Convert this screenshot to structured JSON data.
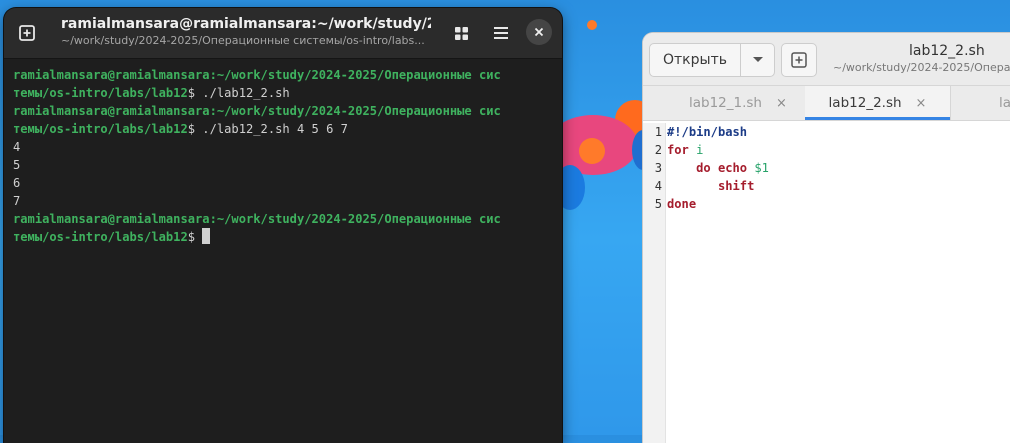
{
  "terminal": {
    "title": "ramialmansara@ramialmansara:~/work/study/2024...",
    "subtitle": "~/work/study/2024-2025/Операционные системы/os-intro/labs...",
    "lines": [
      {
        "prompt": "ramialmansara@ramialmansara:~/work/study/2024-2025/Операционные сис",
        "cmd": ""
      },
      {
        "prompt": "темы/os-intro/labs/lab12",
        "cmd": "$ ./lab12_2.sh"
      },
      {
        "prompt": "ramialmansara@ramialmansara:~/work/study/2024-2025/Операционные сис",
        "cmd": ""
      },
      {
        "prompt": "темы/os-intro/labs/lab12",
        "cmd": "$ ./lab12_2.sh 4 5 6 7"
      },
      {
        "prompt": "",
        "cmd": "4"
      },
      {
        "prompt": "",
        "cmd": "5"
      },
      {
        "prompt": "",
        "cmd": "6"
      },
      {
        "prompt": "",
        "cmd": "7"
      },
      {
        "prompt": "ramialmansara@ramialmansara:~/work/study/2024-2025/Операционные сис",
        "cmd": ""
      },
      {
        "prompt": "темы/os-intro/labs/lab12",
        "cmd": "$ "
      }
    ]
  },
  "editor": {
    "open_label": "Открыть",
    "title": "lab12_2.sh",
    "path": "~/work/study/2024-2025/Опера",
    "tabs": [
      {
        "label": "lab12_1.sh",
        "close": "×"
      },
      {
        "label": "lab12_2.sh",
        "close": "×"
      },
      {
        "label": "la"
      }
    ],
    "line_numbers": [
      "1",
      "2",
      "3",
      "4",
      "5"
    ],
    "code": {
      "l1": "#!/bin/bash",
      "l2_kw": "for",
      "l2_var": "i",
      "l3_indent": "    ",
      "l3_kw1": "do",
      "l3_kw2": "echo",
      "l3_arg": "$1",
      "l4_indent": "       ",
      "l4_kw": "shift",
      "l5_kw": "done"
    }
  },
  "colors": {
    "prompt_green": "#3fb25f",
    "tab_accent": "#3584e4",
    "keyword": "#a51d2d",
    "shebang": "#1c3c87"
  }
}
